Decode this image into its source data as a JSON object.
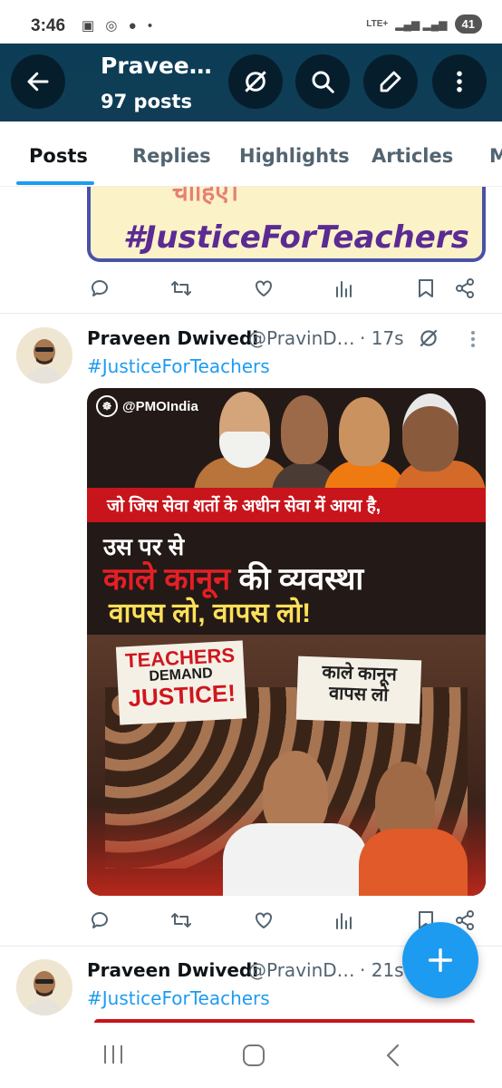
{
  "status": {
    "time": "3:46",
    "network": "LTE+",
    "battery": "41"
  },
  "header": {
    "title": "Pravee…",
    "subtitle": "97 posts"
  },
  "tabs": [
    "Posts",
    "Replies",
    "Highlights",
    "Articles",
    "M"
  ],
  "prev_post": {
    "image_text": "#JusticeForTeachers",
    "image_text_top": "चाहिए।"
  },
  "post1": {
    "name": "Praveen Dwivedi",
    "handle": "@PravinD…",
    "time": "· 17s",
    "text": "#JusticeForTeachers",
    "image": {
      "logo": "@PMOIndia",
      "line1": "जो जिस सेवा शर्तो के अधीन सेवा में आया है,",
      "line2": "उस पर से",
      "line3a": "काले कानून",
      "line3b": "की व्यवस्था",
      "line4": "वापस लो, वापस लो!",
      "sign1": [
        "TEACHERS",
        "DEMAND",
        "JUSTICE!"
      ],
      "sign2": [
        "काले कानून",
        "वापस लो"
      ]
    }
  },
  "post2": {
    "name": "Praveen Dwivedi",
    "handle": "@PravinD…",
    "time": "· 21s",
    "text": "#JusticeForTeachers"
  },
  "colors": {
    "accent": "#1d9bf0",
    "header_bg": "#0c3d57",
    "poster_red": "#c8141b",
    "poster_yellow": "#fde05a"
  },
  "icons": [
    "back-arrow-icon",
    "grok-icon",
    "search-icon",
    "compose-icon",
    "more-vertical-icon",
    "reply-icon",
    "retweet-icon",
    "like-icon",
    "views-icon",
    "bookmark-icon",
    "share-icon",
    "plus-icon"
  ]
}
